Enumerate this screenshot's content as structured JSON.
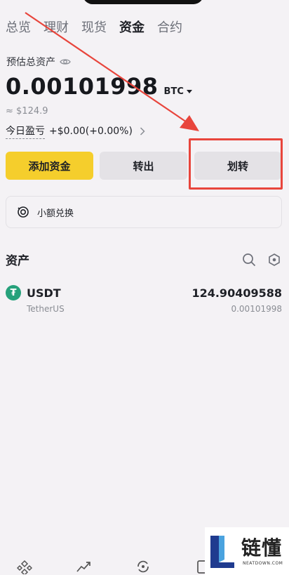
{
  "tabs": [
    {
      "label": "总览"
    },
    {
      "label": "理财"
    },
    {
      "label": "现货"
    },
    {
      "label": "资金"
    },
    {
      "label": "合约"
    }
  ],
  "active_tab": "资金",
  "summary": {
    "estimated_label": "预估总资产",
    "balance": "0.00101998",
    "unit": "BTC",
    "approx_value": "≈ $124.9",
    "pnl_label": "今日盈亏",
    "pnl_value": "+$0.00(+0.00%)"
  },
  "actions": {
    "add_funds": "添加资金",
    "withdraw": "转出",
    "transfer": "划转"
  },
  "small_exchange": {
    "label": "小额兑换"
  },
  "assets": {
    "title": "资产",
    "items": [
      {
        "symbol": "USDT",
        "name": "TetherUS",
        "amount": "124.90409588",
        "btc_value": "0.00101998",
        "icon_glyph": "₮"
      }
    ]
  },
  "watermark": {
    "title": "链懂",
    "url": "NEATDOWN.COM"
  },
  "colors": {
    "accent_yellow": "#f5ce2c",
    "annotation_red": "#e8453c",
    "tether_green": "#26a17b"
  }
}
